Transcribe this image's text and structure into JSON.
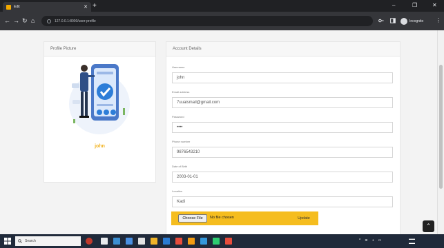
{
  "browser": {
    "tab_title": "Edit",
    "url": "127.0.0.1:8000/user-profile",
    "incognito_label": "Incognito"
  },
  "profile_picture": {
    "header": "Profile Picture",
    "name": "john"
  },
  "account": {
    "header": "Account Details",
    "fields": [
      {
        "label": "Username",
        "value": "john"
      },
      {
        "label": "Email address",
        "value": "7uuaismail@gmail.com"
      },
      {
        "label": "Password",
        "value": "••••"
      },
      {
        "label": "Phone number",
        "value": "9876543210"
      },
      {
        "label": "Date of Birth",
        "value": "2003-01-01"
      },
      {
        "label": "Location",
        "value": "Kadi"
      }
    ],
    "choose_file_label": "Choose File",
    "no_file_text": "No file chosen",
    "update_label": "Update"
  },
  "taskbar": {
    "search_placeholder": "Search"
  },
  "colors": {
    "accent": "#f5bd1f",
    "name_color": "#f2b21d"
  }
}
